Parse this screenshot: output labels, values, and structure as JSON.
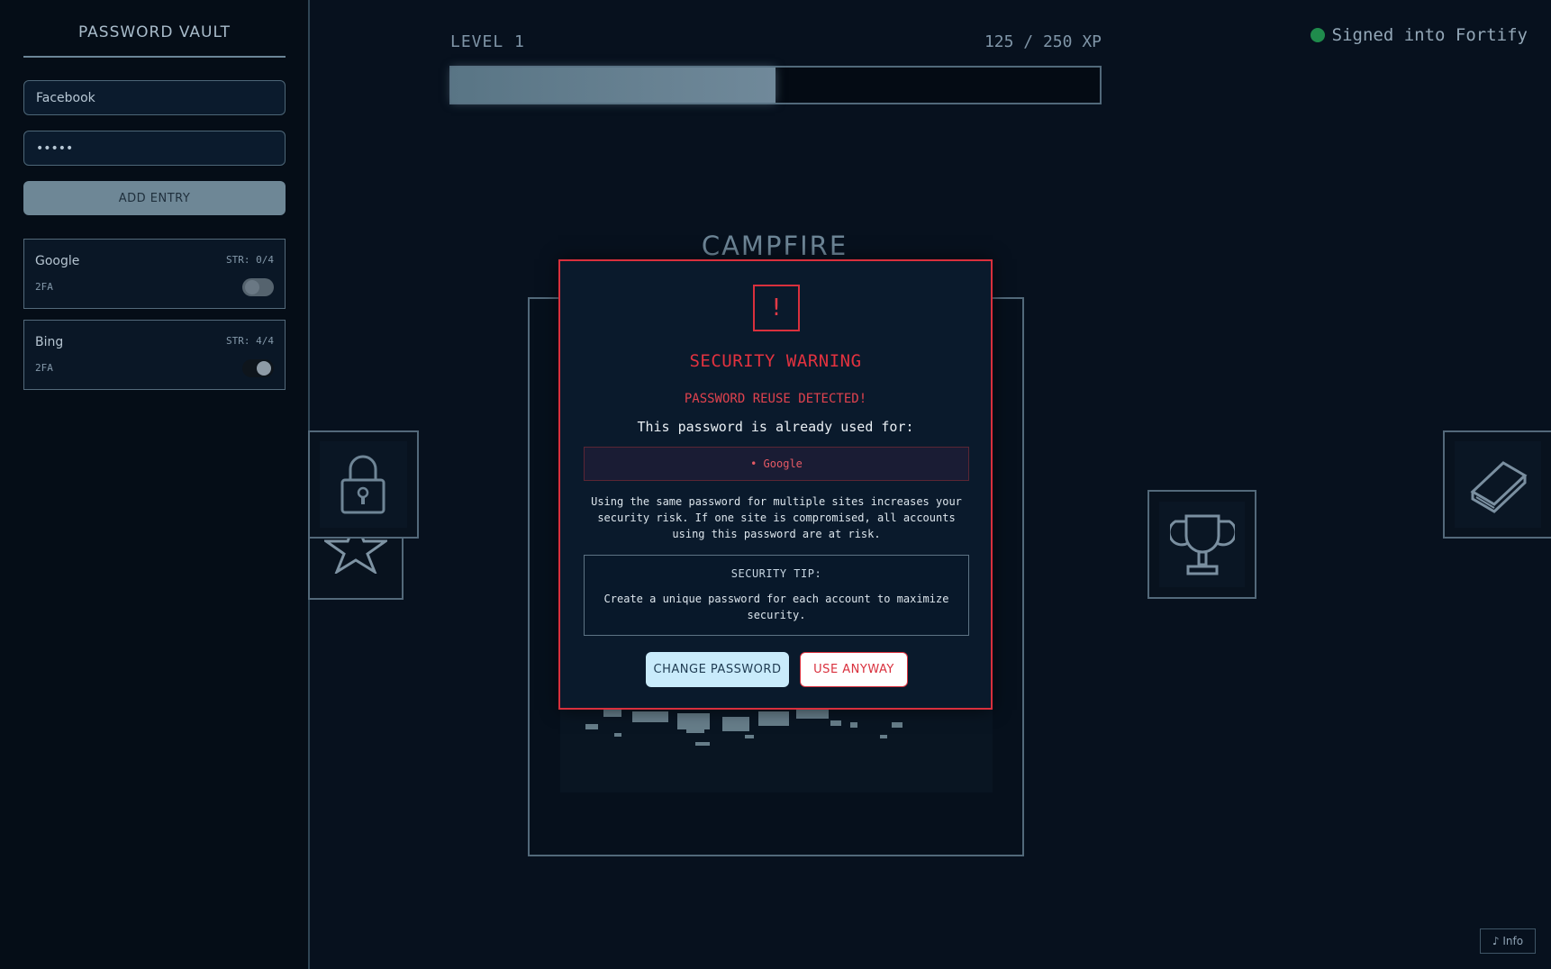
{
  "sidebar": {
    "title": "PASSWORD VAULT",
    "site_input": {
      "value": "Facebook",
      "placeholder": ""
    },
    "password_input": {
      "value": "•••••"
    },
    "add_button": "ADD ENTRY",
    "entries": [
      {
        "name": "Google",
        "strength": "STR: 0/4",
        "twofa_label": "2FA",
        "twofa_enabled": false
      },
      {
        "name": "Bing",
        "strength": "STR: 4/4",
        "twofa_label": "2FA",
        "twofa_enabled": true
      }
    ]
  },
  "progress": {
    "level": "LEVEL 1",
    "xp_text": "125 / 250 XP",
    "xp_current": 125,
    "xp_max": 250
  },
  "status": {
    "text": "Signed into Fortify",
    "color": "#1f8b4c"
  },
  "scene": {
    "title": "CAMPFIRE",
    "tiles": [
      "lock-icon",
      "star-icon",
      "trophy-icon",
      "book-icon"
    ]
  },
  "modal": {
    "icon": "!",
    "title": "SECURITY WARNING",
    "subtitle": "PASSWORD REUSE DETECTED!",
    "used_for_label": "This password is already used for:",
    "used_sites": "• Google",
    "explanation": "Using the same password for multiple sites increases your security risk. If one site is compromised, all accounts using this password are at risk.",
    "tip_title": "SECURITY TIP:",
    "tip_text": "Create a unique password for each account to maximize security.",
    "change_button": "CHANGE PASSWORD",
    "use_button": "USE ANYWAY",
    "accent_color": "#d9303d"
  },
  "footer": {
    "info_button": "♪ Info"
  }
}
